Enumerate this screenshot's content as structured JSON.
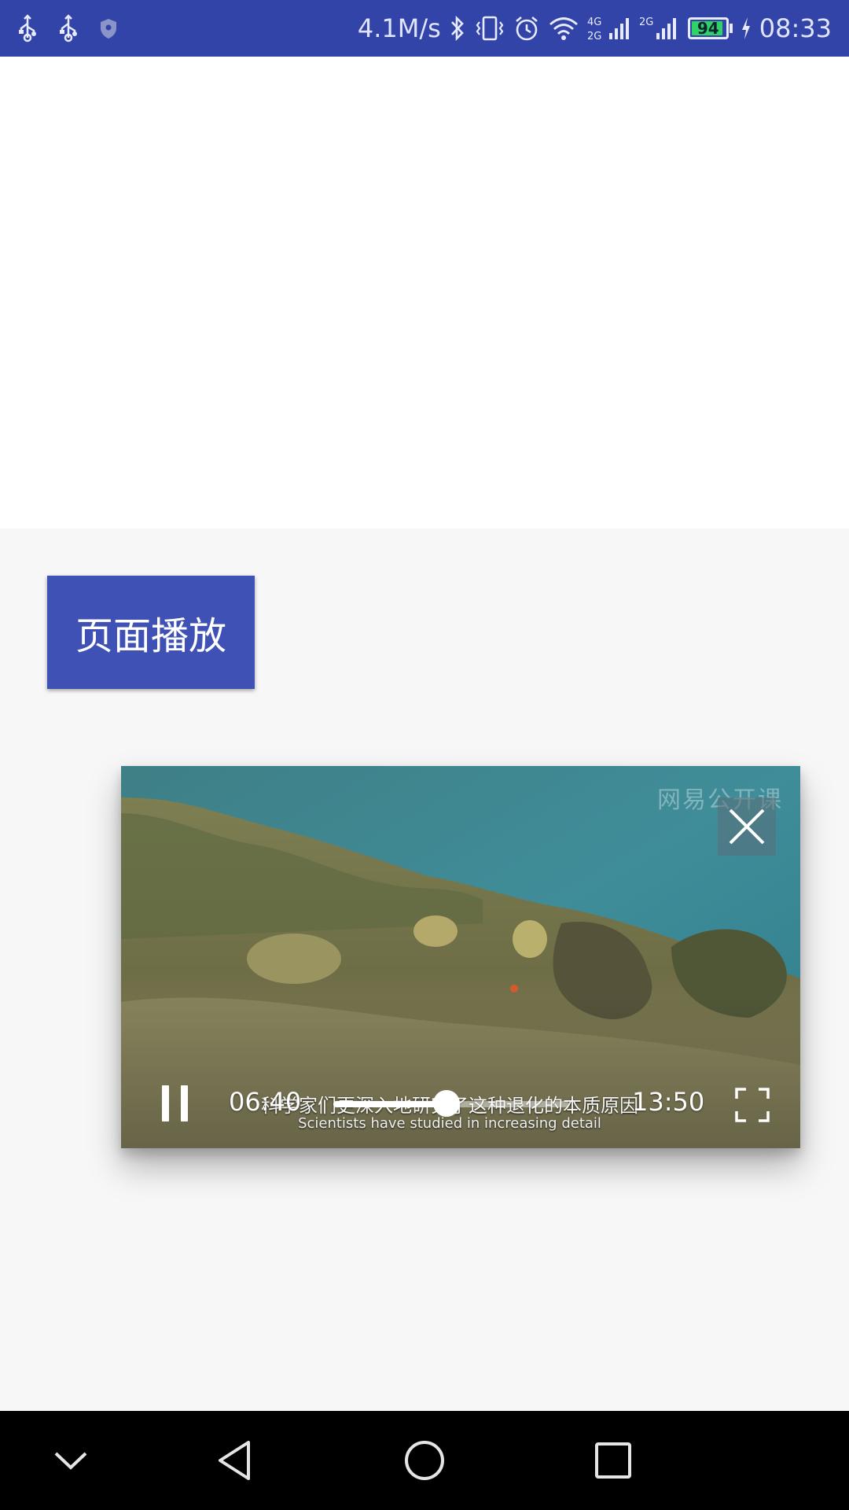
{
  "status_bar": {
    "left_icons": [
      "usb-icon",
      "usb-icon",
      "shield-icon"
    ],
    "network_speed": "4.1M/s",
    "right_icons": [
      "bluetooth-icon",
      "vibrate-icon",
      "alarm-icon",
      "wifi-icon",
      "signal-4g-icon",
      "signal-2g-icon"
    ],
    "network_labels": [
      "4G",
      "2G",
      "2G"
    ],
    "battery_level": "94",
    "battery_fraction": 0.94,
    "time": "08:33",
    "colors": {
      "background": "#3344a8",
      "battery_fill": "#2ed266"
    }
  },
  "main": {
    "play_button_label": "页面播放",
    "colors": {
      "play_button": "#3f51b5",
      "page_background": "#f7f7f7"
    }
  },
  "video_player": {
    "watermark": "网易公开课",
    "subtitle_cn": "科学家们更深入地研究了这种退化的本质原因",
    "subtitle_en": "Scientists have studied in increasing detail",
    "current_time": "06:40",
    "total_time": "13:50",
    "progress_fraction": 0.48,
    "icons": [
      "close-icon",
      "pause-icon",
      "fullscreen-icon"
    ]
  },
  "nav_bar": {
    "icons": [
      "chevron-down-icon",
      "back-icon",
      "home-icon",
      "recents-icon"
    ]
  }
}
